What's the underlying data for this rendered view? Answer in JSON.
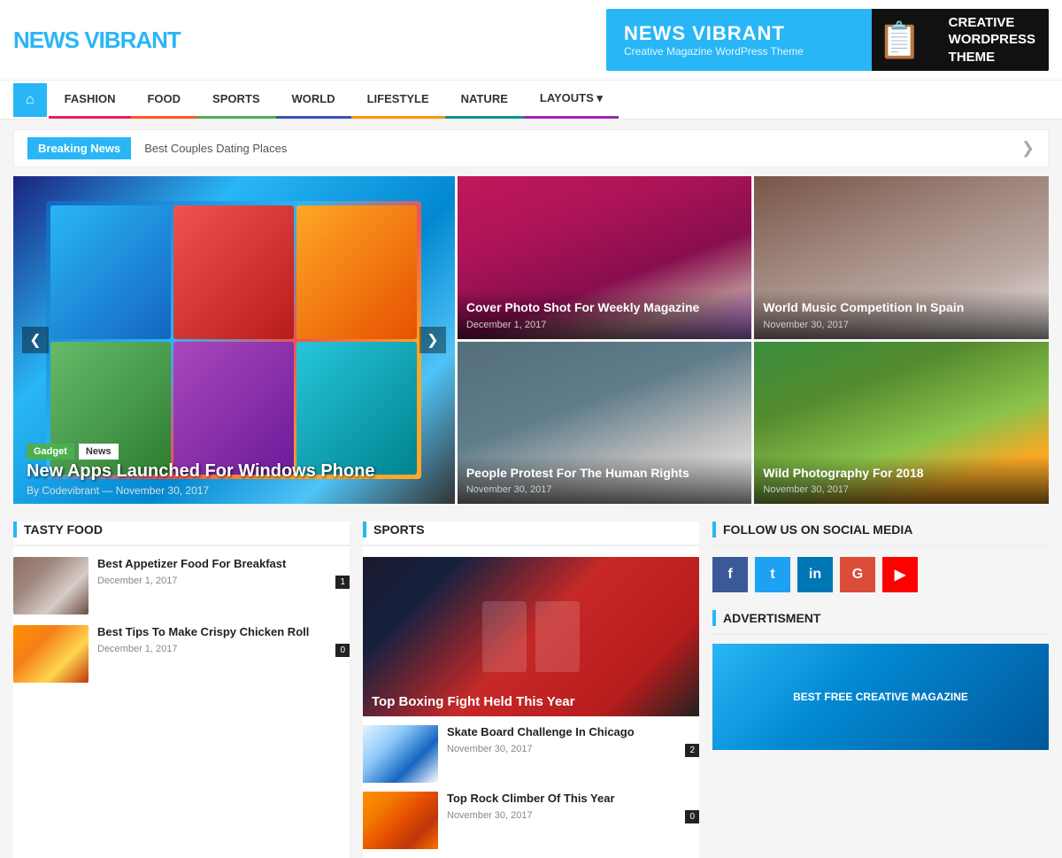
{
  "header": {
    "logo_text": "NEWS ",
    "logo_accent": "VIBRANT",
    "ad_title": "NEWS VIBRANT",
    "ad_subtitle": "Creative Magazine WordPress Theme",
    "ad_right": "CREATIVE\nWORDPRESS\nTHEME"
  },
  "nav": {
    "home_icon": "⌂",
    "items": [
      {
        "label": "FASHION",
        "class": "fashion"
      },
      {
        "label": "FOOD",
        "class": "food"
      },
      {
        "label": "SPORTS",
        "class": "sports"
      },
      {
        "label": "WORLD",
        "class": "world"
      },
      {
        "label": "LIFESTYLE",
        "class": "lifestyle"
      },
      {
        "label": "NATURE",
        "class": "nature"
      },
      {
        "label": "LAYOUTS ▾",
        "class": "layouts"
      }
    ]
  },
  "breaking_news": {
    "tag": "Breaking News",
    "text": "Best Couples Dating Places",
    "arrow": "❮"
  },
  "hero": {
    "tags": [
      "Gadget",
      "News"
    ],
    "title": "New Apps Launched For Windows Phone",
    "meta": "By Codevibrant — November 30, 2017"
  },
  "side_articles": [
    {
      "title": "Cover Photo Shot For Weekly Magazine",
      "date": "December 1, 2017",
      "color": "beauty"
    },
    {
      "title": "People Protest For The Human Rights",
      "date": "November 30, 2017",
      "color": "protest"
    },
    {
      "title": "World Music Competition In Spain",
      "date": "November 30, 2017",
      "color": "violin"
    },
    {
      "title": "Wild Photography For 2018",
      "date": "November 30, 2017",
      "color": "tiger"
    }
  ],
  "tasty_food": {
    "section_title": "TASTY FOOD",
    "items": [
      {
        "title": "Best Appetizer Food For Breakfast",
        "date": "December 1, 2017",
        "count": "1",
        "color": "churro"
      },
      {
        "title": "Best Tips To Make Crispy Chicken Roll",
        "date": "December 1, 2017",
        "count": "0",
        "color": "wrap"
      }
    ]
  },
  "sports": {
    "section_title": "SPORTS",
    "big_article": {
      "title": "Top Boxing Fight Held This Year"
    },
    "small_articles": [
      {
        "title": "Skate Board Challenge In Chicago",
        "date": "November 30, 2017",
        "count": "2",
        "color": "ski"
      },
      {
        "title": "Top Rock Climber Of This Year",
        "date": "November 30, 2017",
        "count": "0",
        "color": "climb"
      }
    ]
  },
  "social": {
    "section_title": "FOLLOW US ON SOCIAL MEDIA",
    "buttons": [
      {
        "label": "f",
        "class": "sb-fb",
        "name": "facebook"
      },
      {
        "label": "t",
        "class": "sb-tw",
        "name": "twitter"
      },
      {
        "label": "in",
        "class": "sb-li",
        "name": "linkedin"
      },
      {
        "label": "G",
        "class": "sb-gp",
        "name": "google-plus"
      },
      {
        "label": "▶",
        "class": "sb-yt",
        "name": "youtube"
      }
    ],
    "ad_title": "ADVERTISMENT",
    "ad_text": "BEST FREE CREATIVE MAGAZINE"
  }
}
